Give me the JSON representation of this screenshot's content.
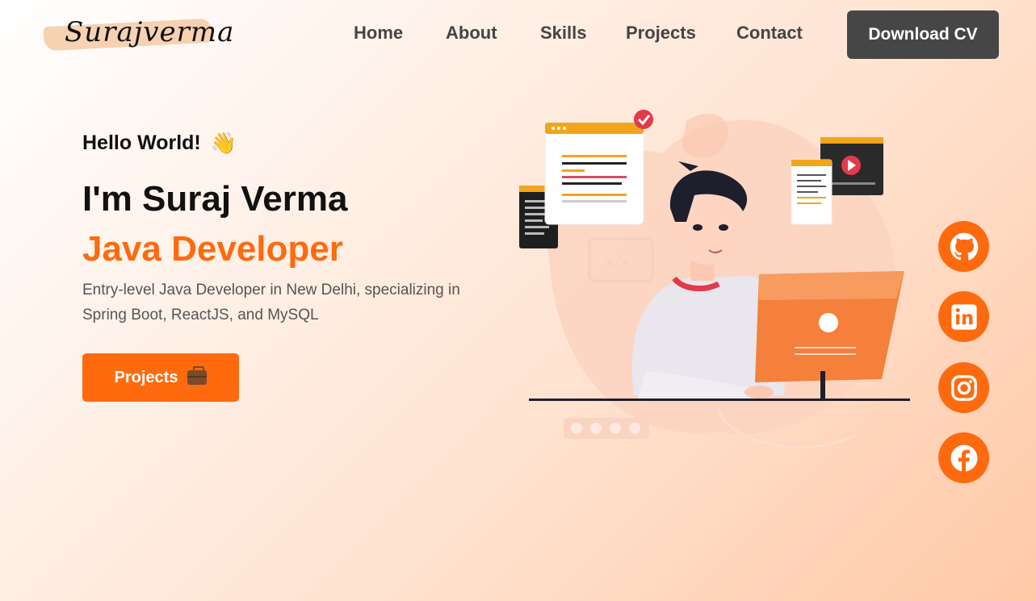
{
  "header": {
    "logo_text": "Surajverma",
    "nav": [
      {
        "label": "Home"
      },
      {
        "label": "About"
      },
      {
        "label": "Skills"
      },
      {
        "label": "Projects"
      },
      {
        "label": "Contact"
      }
    ],
    "download_label": "Download CV"
  },
  "hero": {
    "greeting": "Hello World!",
    "wave_emoji": "👋",
    "name": "I'm Suraj Verma",
    "role": "Java Developer",
    "description": "Entry-level Java Developer in New Delhi, specializing in Spring Boot, ReactJS, and MySQL",
    "projects_button": "Projects",
    "projects_icon": "briefcase-icon"
  },
  "social": [
    {
      "icon": "github-icon"
    },
    {
      "icon": "linkedin-icon"
    },
    {
      "icon": "instagram-icon"
    },
    {
      "icon": "facebook-icon"
    }
  ],
  "colors": {
    "accent": "#ff6a0f",
    "dark_button": "#464646",
    "text": "#111111",
    "muted": "#555555"
  }
}
